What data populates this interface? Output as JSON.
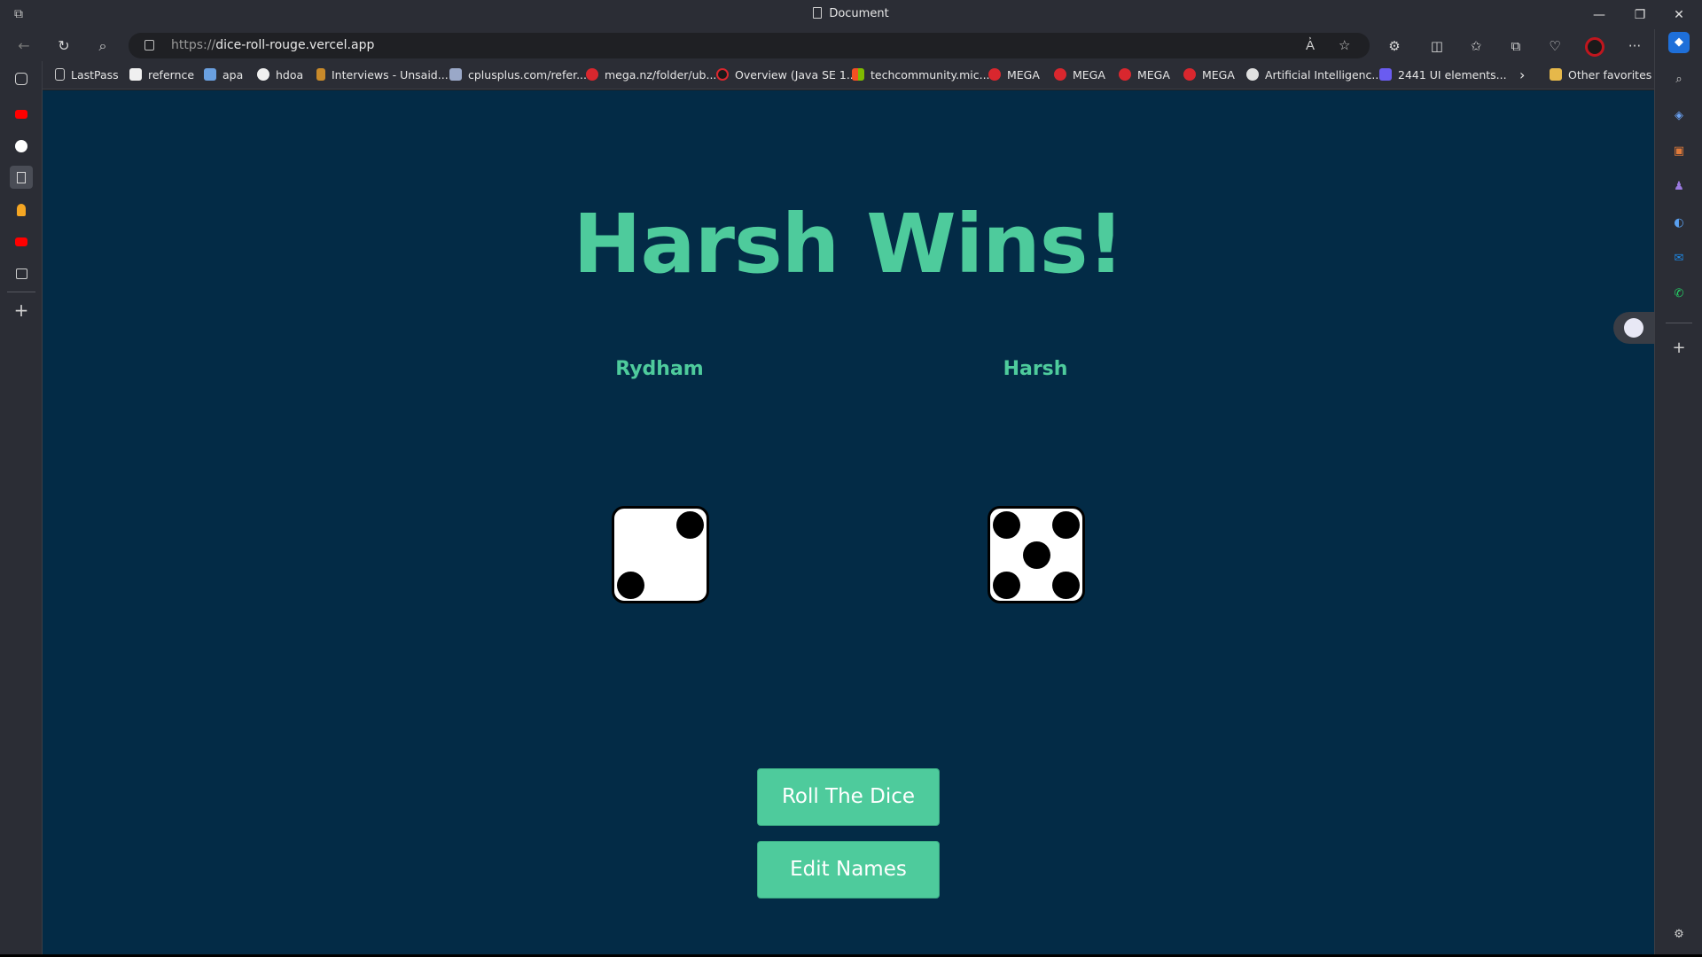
{
  "window": {
    "title": "Document",
    "controls": {
      "minimize": "—",
      "restore": "❐",
      "close": "✕"
    }
  },
  "navbar": {
    "url_protocol": "https://",
    "url_host": "dice-roll-rouge.vercel.app",
    "back_icon": "←",
    "reload_icon": "↻",
    "search_icon": "⌕",
    "more_icon": "···"
  },
  "favorites": {
    "items": [
      {
        "label": "LastPass",
        "icon_color": "#cfcfcf"
      },
      {
        "label": "refernce",
        "icon_color": "#f0f0f0"
      },
      {
        "label": "apa",
        "icon_color": "#6aa0e0"
      },
      {
        "label": "hdoa",
        "icon_color": "#f0f0f0"
      },
      {
        "label": "Interviews - Unsaid...",
        "icon_color": "#c98a2a"
      },
      {
        "label": "cplusplus.com/refer...",
        "icon_color": "#9aa8c8"
      },
      {
        "label": "mega.nz/folder/ub...",
        "icon_color": "#d9272e"
      },
      {
        "label": "Overview (Java SE 1...",
        "icon_color": "#d9272e"
      },
      {
        "label": "techcommunity.mic...",
        "icon_color": "#f25022"
      },
      {
        "label": "MEGA",
        "icon_color": "#d9272e"
      },
      {
        "label": "MEGA",
        "icon_color": "#d9272e"
      },
      {
        "label": "MEGA",
        "icon_color": "#d9272e"
      },
      {
        "label": "MEGA",
        "icon_color": "#d9272e"
      },
      {
        "label": "Artificial Intelligenc...",
        "icon_color": "#e0e0e0"
      },
      {
        "label": "2441 UI elements...",
        "icon_color": "#6a5cf0"
      }
    ],
    "overflow_icon": "›",
    "other_label": "Other favorites"
  },
  "game": {
    "result_text": "Harsh Wins!",
    "players": [
      {
        "name": "Rydham",
        "die_value": 2
      },
      {
        "name": "Harsh",
        "die_value": 5
      }
    ],
    "roll_button_label": "Roll The Dice",
    "edit_button_label": "Edit Names"
  },
  "colors": {
    "accent": "#4ecb9c",
    "page_bg": "#032b46",
    "chrome_bg": "#2b2d35"
  }
}
